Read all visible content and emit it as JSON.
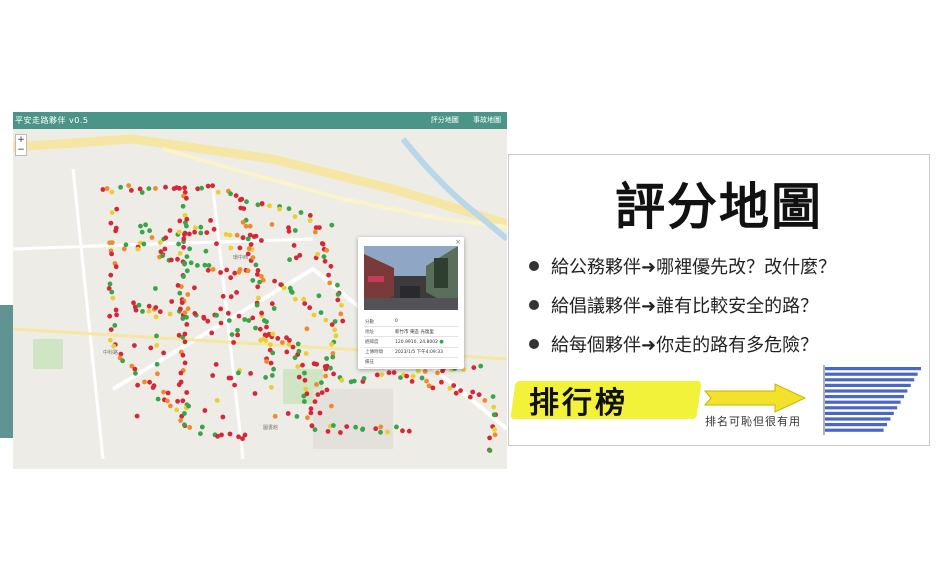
{
  "app": {
    "title": "平安走路夥伴 v0.5",
    "nav": [
      "評分地圖",
      "事故地圖"
    ],
    "zoom": [
      "+",
      "−"
    ]
  },
  "map": {
    "labels": [
      "環中西",
      "中科路",
      "圖書館"
    ]
  },
  "popup": {
    "close": "×",
    "rows": [
      {
        "key": "分數",
        "value": "0"
      },
      {
        "key": "地址",
        "value": "新竹市 東區 光復里"
      },
      {
        "key": "經緯度",
        "value": "120.9910, 24.8002"
      },
      {
        "key": "上傳時間",
        "value": "2023/1/5 下午4:09:33"
      },
      {
        "key": "備註",
        "value": ""
      }
    ]
  },
  "panel": {
    "title": "評分地圖",
    "bullets": [
      "給公務夥伴➜哪裡優先改？改什麼？",
      "給倡議夥伴➜誰有比較安全的路？",
      "給每個夥伴➜你走的路有多危險？"
    ],
    "ranking_label": "排行榜",
    "ranking_note": "排名可恥但很有用"
  },
  "colors": {
    "nav": "#4b9488",
    "side_accent": "#5f9493",
    "dot_red": "#d62738",
    "dot_orange": "#f08a2c",
    "dot_yellow": "#e9cf2f",
    "dot_green": "#3aa44a",
    "bar_blue": "#4a67c7",
    "highlight": "#f3f23b"
  }
}
